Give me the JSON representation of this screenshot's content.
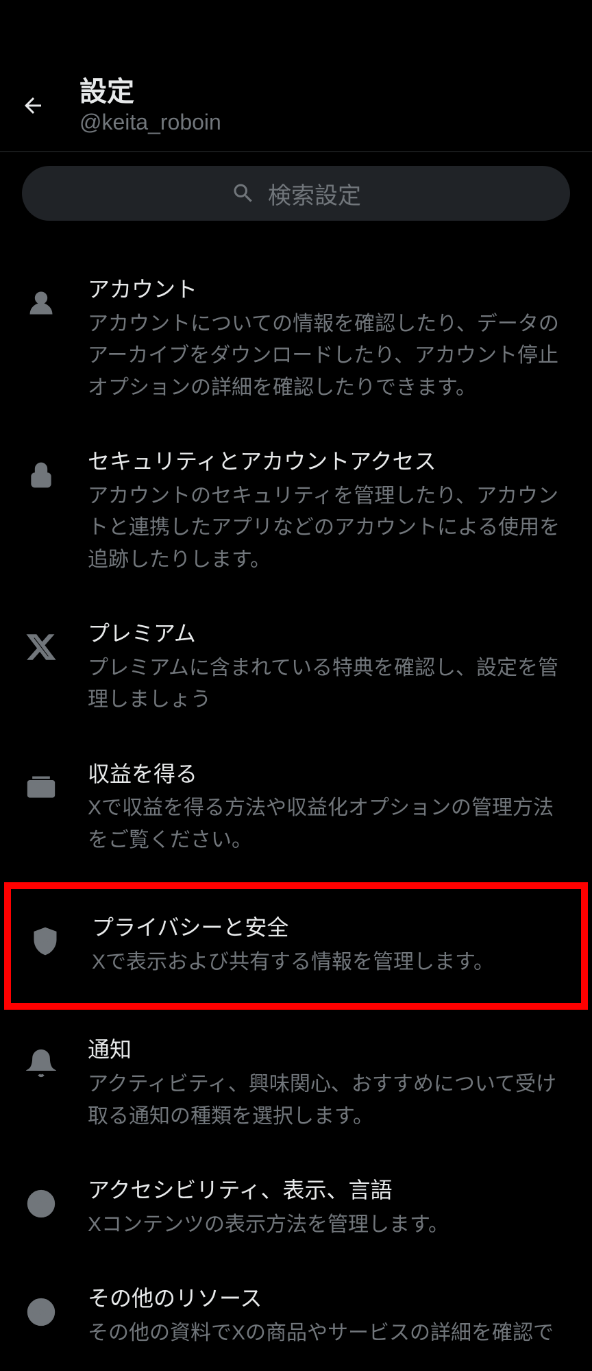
{
  "header": {
    "title": "設定",
    "username": "@keita_roboin"
  },
  "search": {
    "placeholder": "検索設定"
  },
  "items": [
    {
      "title": "アカウント",
      "desc": "アカウントについての情報を確認したり、データのアーカイブをダウンロードしたり、アカウント停止オプションの詳細を確認したりできます。"
    },
    {
      "title": "セキュリティとアカウントアクセス",
      "desc": "アカウントのセキュリティを管理したり、アカウントと連携したアプリなどのアカウントによる使用を追跡したりします。"
    },
    {
      "title": "プレミアム",
      "desc": "プレミアムに含まれている特典を確認し、設定を管理しましょう"
    },
    {
      "title": "収益を得る",
      "desc": "Xで収益を得る方法や収益化オプションの管理方法をご覧ください。"
    },
    {
      "title": "プライバシーと安全",
      "desc": "Xで表示および共有する情報を管理します。"
    },
    {
      "title": "通知",
      "desc": "アクティビティ、興味関心、おすすめについて受け取る通知の種類を選択します。"
    },
    {
      "title": "アクセシビリティ、表示、言語",
      "desc": "Xコンテンツの表示方法を管理します。"
    },
    {
      "title": "その他のリソース",
      "desc": "その他の資料でXの商品やサービスの詳細を確認で"
    }
  ]
}
